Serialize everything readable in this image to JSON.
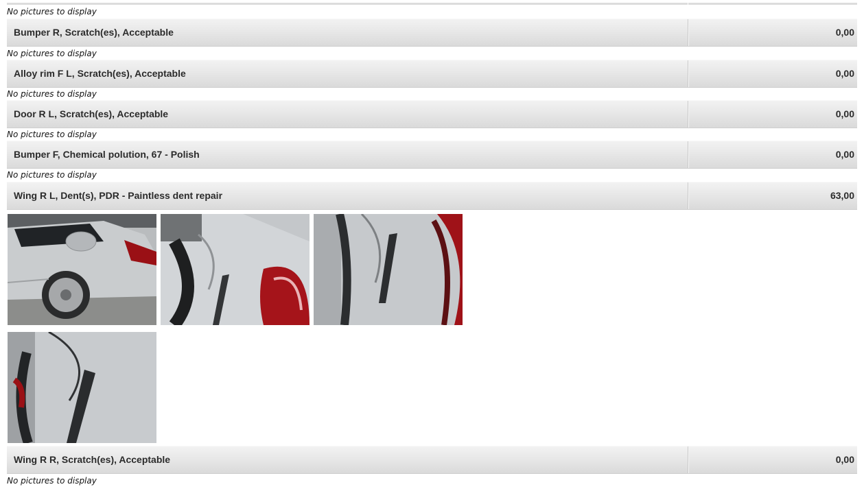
{
  "no_pictures_text": "No pictures to display",
  "items": [
    {
      "label": "Bumper R, Scratch(es), Acceptable",
      "amount": "0,00"
    },
    {
      "label": "Alloy rim F L, Scratch(es), Acceptable",
      "amount": "0,00"
    },
    {
      "label": "Door R L, Scratch(es), Acceptable",
      "amount": "0,00"
    },
    {
      "label": "Bumper F, Chemical polution, 67 - Polish",
      "amount": "0,00"
    },
    {
      "label": "Wing R L, Dent(s), PDR - Paintless dent repair",
      "amount": "63,00"
    },
    {
      "label": "Wing R R, Scratch(es), Acceptable",
      "amount": "0,00"
    }
  ],
  "photos": [
    {
      "subject": "silver-car-rear-side-photo"
    },
    {
      "subject": "wing-dent-closeup-photo"
    },
    {
      "subject": "wing-dent-closeup-photo"
    },
    {
      "subject": "wing-dent-closeup-photo"
    }
  ],
  "colors": {
    "row_gradient_top": "#f2f2f2",
    "row_gradient_bottom": "#dadada",
    "text": "#2b2b2b",
    "taillight_red": "#b3141b"
  }
}
